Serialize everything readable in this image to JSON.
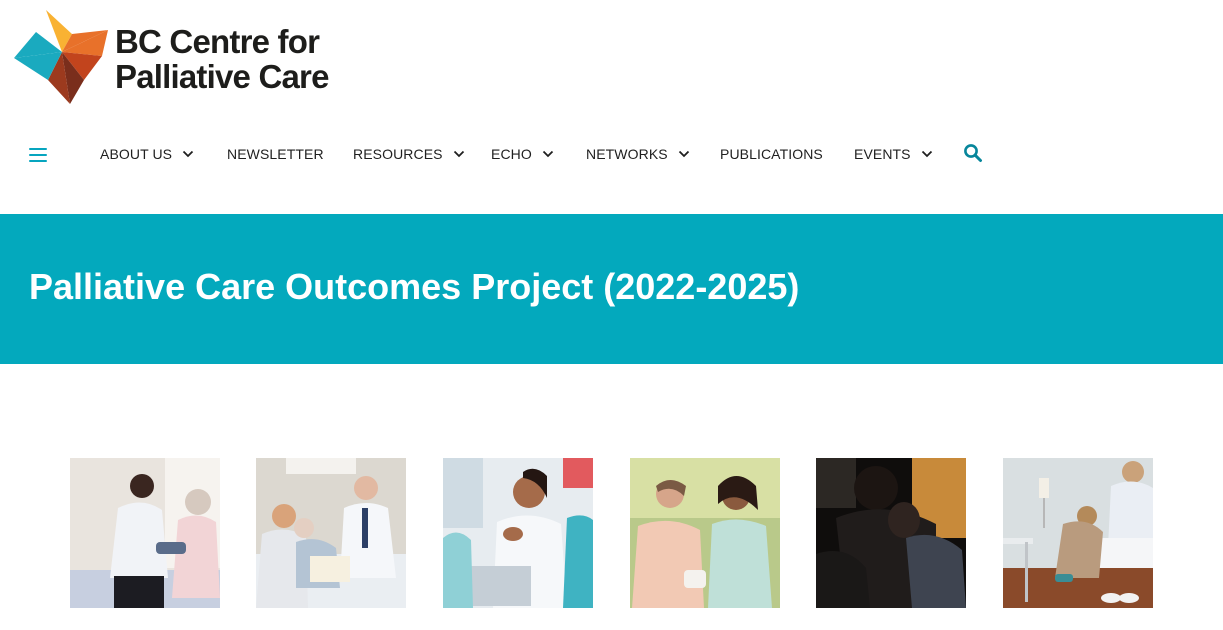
{
  "logo": {
    "line1": "BC Centre for",
    "line2": "Palliative Care",
    "colors": [
      "#f9b233",
      "#e8712a",
      "#c2441d",
      "#7a2e1c",
      "#1aaabf"
    ]
  },
  "nav": {
    "menu_icon": "hamburger-icon",
    "items": [
      {
        "label": "ABOUT US",
        "has_dropdown": true
      },
      {
        "label": "NEWSLETTER",
        "has_dropdown": false
      },
      {
        "label": "RESOURCES",
        "has_dropdown": true
      },
      {
        "label": "ECHO",
        "has_dropdown": true
      },
      {
        "label": "NETWORKS",
        "has_dropdown": true
      },
      {
        "label": "PUBLICATIONS",
        "has_dropdown": false
      },
      {
        "label": "EVENTS",
        "has_dropdown": true
      }
    ],
    "search_icon": "search-icon",
    "accent": "#07a5bf"
  },
  "banner": {
    "title": "Palliative Care Outcomes Project (2022-2025)",
    "bg": "#03a9bd"
  },
  "photos": [
    {
      "name": "nurse-with-elderly-patient-photo"
    },
    {
      "name": "doctor-visiting-patient-in-bed-photo"
    },
    {
      "name": "clinician-discussion-photo"
    },
    {
      "name": "caregiver-with-senior-woman-photo"
    },
    {
      "name": "dark-portrait-embrace-photo"
    },
    {
      "name": "caregiver-helping-with-slippers-photo"
    }
  ]
}
